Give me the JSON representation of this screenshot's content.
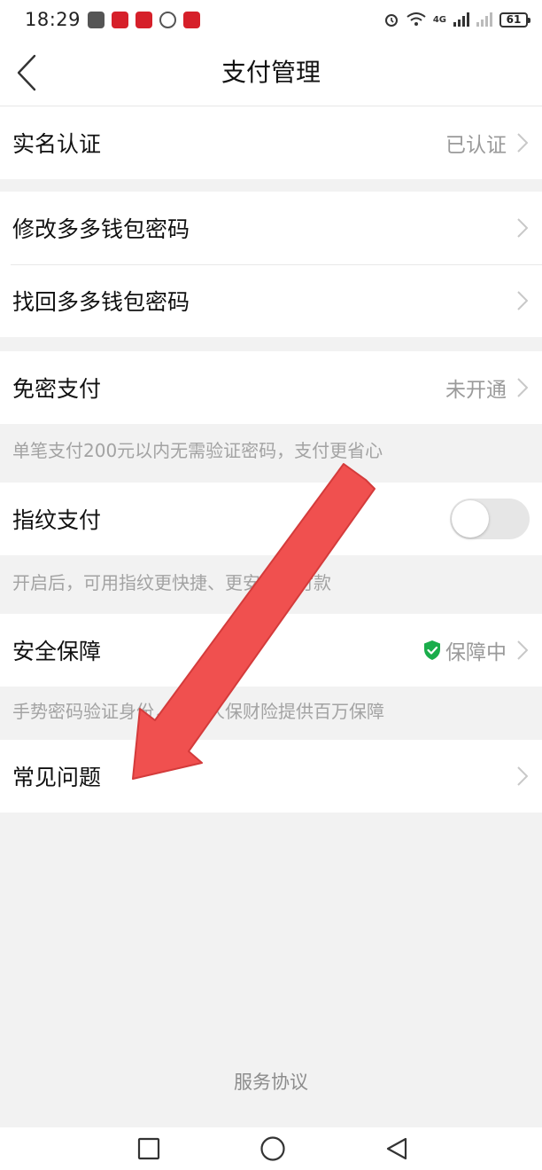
{
  "status_bar": {
    "time": "18:29",
    "battery": "61",
    "network": "4G"
  },
  "nav": {
    "title": "支付管理"
  },
  "rows": {
    "real_name": {
      "label": "实名认证",
      "value": "已认证"
    },
    "change_password": {
      "label": "修改多多钱包密码"
    },
    "recover_password": {
      "label": "找回多多钱包密码"
    },
    "password_free": {
      "label": "免密支付",
      "value": "未开通",
      "hint": "单笔支付200元以内无需验证密码，支付更省心"
    },
    "fingerprint": {
      "label": "指纹支付",
      "enabled": false,
      "hint": "开启后，可用指纹更快捷、更安全地付款"
    },
    "security": {
      "label": "安全保障",
      "value": "保障中",
      "hint": "手势密码验证身份，联合人保财险提供百万保障"
    },
    "faq": {
      "label": "常见问题"
    }
  },
  "footer": {
    "service_agreement": "服务协议"
  },
  "colors": {
    "shield_green": "#1aad4b",
    "arrow_red": "#f0504f",
    "background": "#f2f2f2"
  },
  "icons": [
    "back-arrow-icon",
    "chevron-right-icon",
    "shield-check-icon",
    "home-square-icon",
    "home-circle-icon",
    "back-triangle-icon"
  ]
}
